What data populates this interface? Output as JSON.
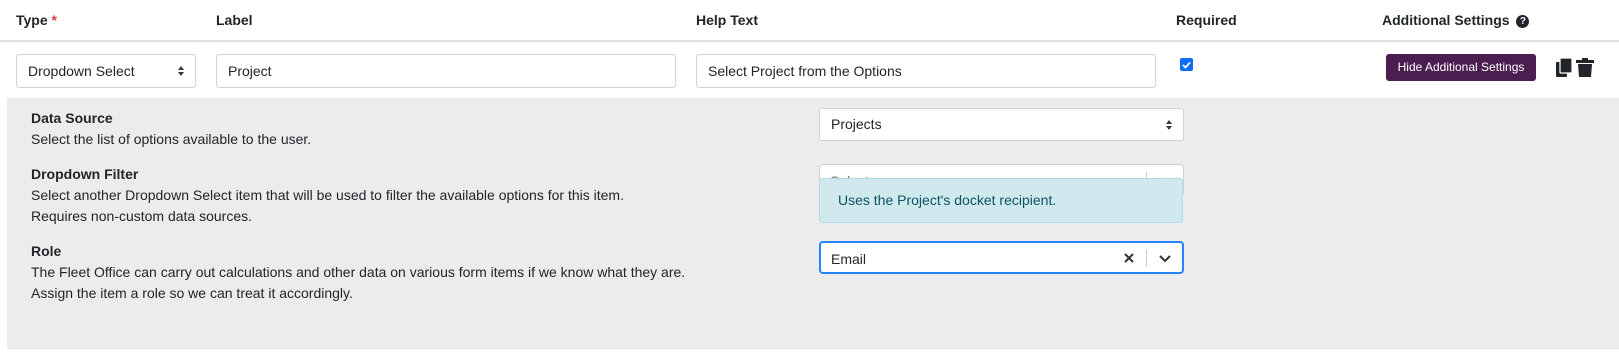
{
  "header": {
    "type_label": "Type",
    "required_star": "*",
    "label_label": "Label",
    "help_text_label": "Help Text",
    "required_label": "Required",
    "additional_settings_label": "Additional Settings",
    "help_icon": "question-circle-icon"
  },
  "item": {
    "type_value": "Dropdown Select",
    "label_value": "Project",
    "help_text_value": "Select Project from the Options",
    "required_checked": true,
    "hide_settings_button": "Hide Additional Settings",
    "duplicate_icon": "copy-icon",
    "delete_icon": "trash-icon"
  },
  "settings": {
    "data_source": {
      "title": "Data Source",
      "description": "Select the list of options available to the user.",
      "value": "Projects"
    },
    "dropdown_filter": {
      "title": "Dropdown Filter",
      "description_line1": "Select another Dropdown Select item that will be used to filter the available options for this item.",
      "description_line2": "Requires non-custom data sources.",
      "placeholder": "Select..."
    },
    "role": {
      "title": "Role",
      "description_line1": "The Fleet Office can carry out calculations and other data on various form items if we know what they are.",
      "description_line2": "Assign the item a role so we can treat it accordingly.",
      "value": "Email",
      "info": "Uses the Project's docket recipient."
    }
  },
  "colors": {
    "button_bg": "#4a1f4f",
    "settings_bg": "#ececec",
    "info_bg": "#cfe9ef",
    "focus_border": "#2684ff",
    "checkbox": "#0d6efd",
    "required_star": "#dc3545"
  }
}
